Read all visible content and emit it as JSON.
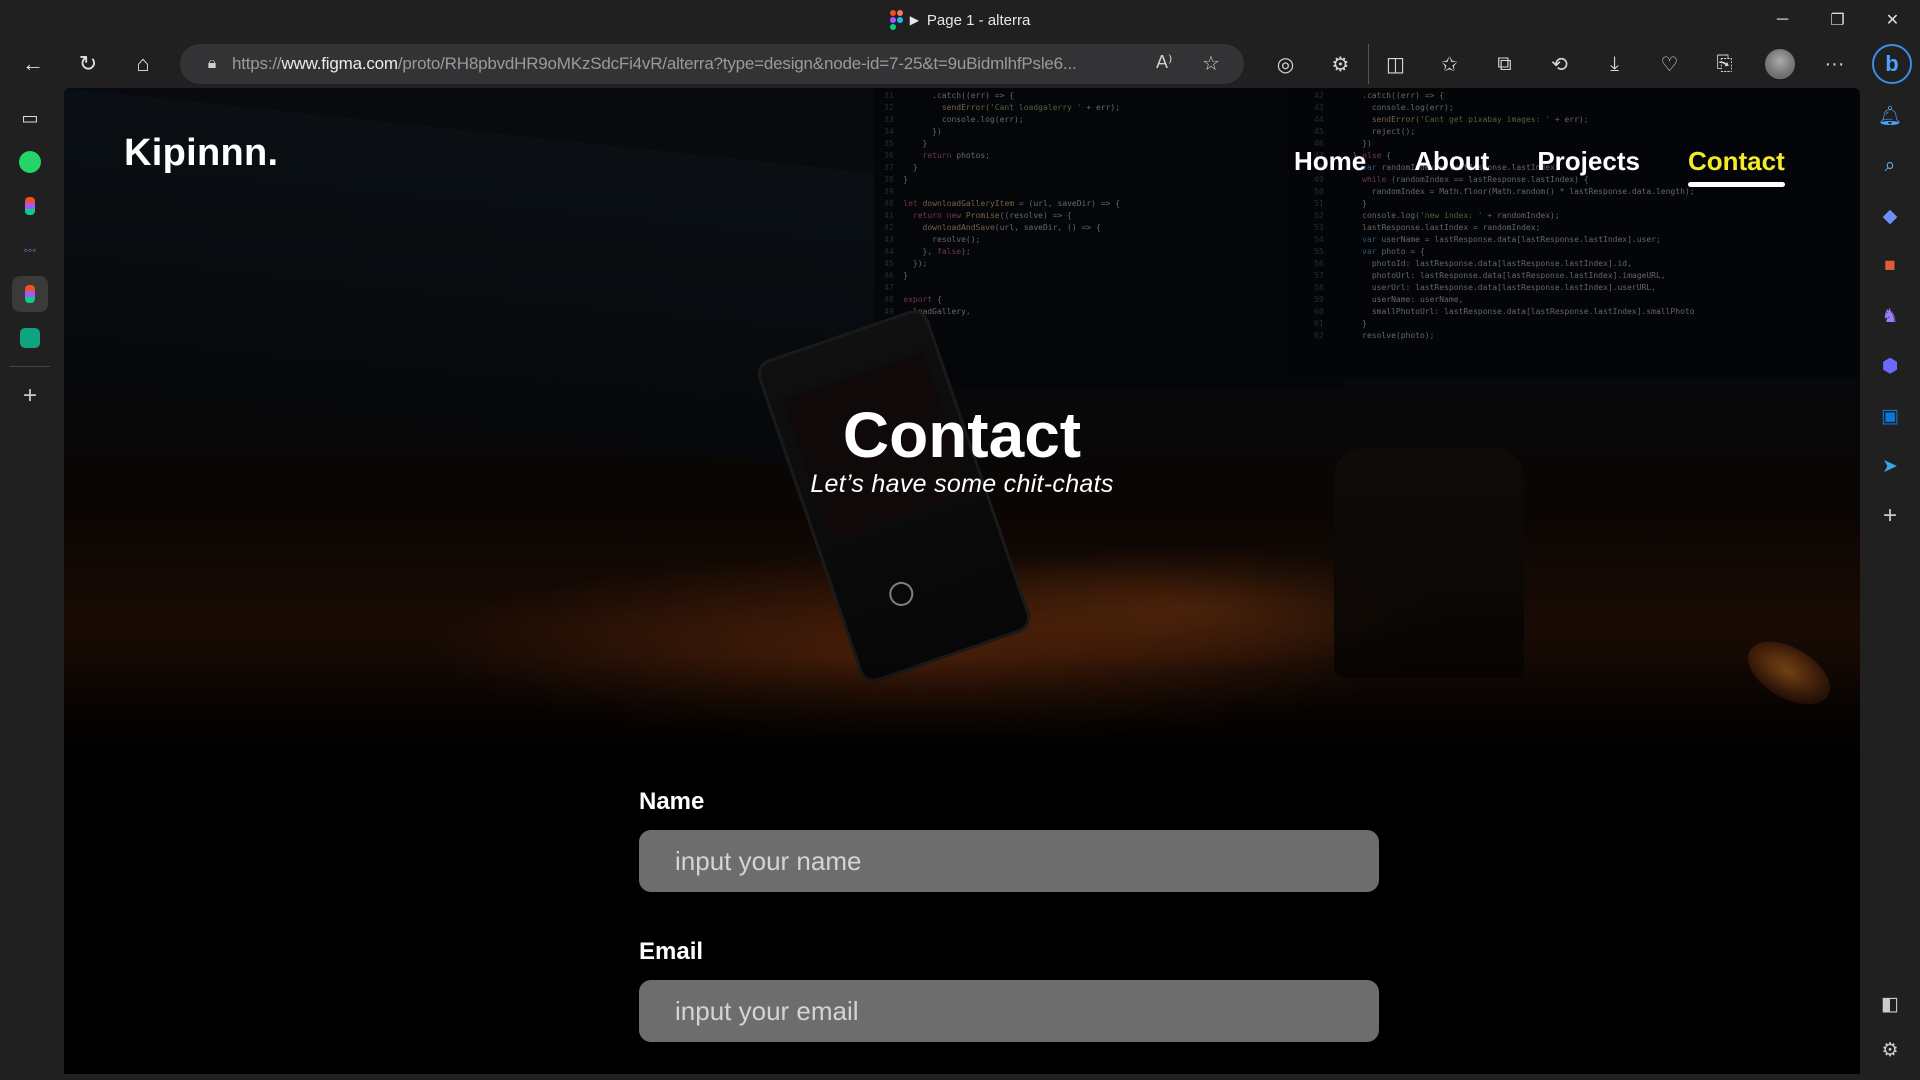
{
  "browser": {
    "tab_title": "Page 1 - alterra",
    "url_prefix": "https://",
    "url_host": "www.figma.com",
    "url_path": "/proto/RH8pbvdHR9oMKzSdcFi4vR/alterra?type=design&node-id=7-25&t=9uBidmlhfPsle6...",
    "window_controls": [
      "minimize-icon",
      "restore-icon",
      "close-icon"
    ],
    "nav_icons": [
      "back-arrow-icon",
      "reload-icon",
      "home-icon"
    ],
    "address_icons": [
      "lock-icon",
      "read-aloud-icon",
      "favorite-star-icon"
    ],
    "toolbar_icons": [
      "tracking-icon",
      "extensions-icon",
      "split-screen-icon",
      "favorites-icon",
      "collections-icon",
      "history-icon",
      "downloads-icon",
      "performance-icon",
      "screenshot-icon",
      "profile-avatar",
      "more-icon"
    ],
    "read_aloud_glyph": "A⁾",
    "more_glyph": "···",
    "copilot_glyph": "b"
  },
  "left_sidebar": [
    "tab-actions-icon",
    "whatsapp-icon",
    "figma-icon",
    "app-icon",
    "figma-icon-active",
    "chatgpt-icon",
    "add-icon"
  ],
  "right_sidebar": [
    "bell-icon",
    "search-icon",
    "tag-icon",
    "toolbox-icon",
    "chess-icon",
    "copilot-icon",
    "outlook-icon",
    "send-icon",
    "add-icon",
    "sidebar-toggle-icon",
    "settings-icon"
  ],
  "site": {
    "brand": "Kipinnn.",
    "nav": [
      {
        "label": "Home"
      },
      {
        "label": "About"
      },
      {
        "label": "Projects"
      },
      {
        "label": "Contact",
        "current": true
      }
    ],
    "accent_color": "#f5ea2a",
    "hero": {
      "title": "Contact",
      "subtitle": "Let’s have some chit-chats"
    },
    "form": {
      "name_label": "Name",
      "name_placeholder": "input your name",
      "email_label": "Email",
      "email_placeholder": "input your email"
    }
  }
}
